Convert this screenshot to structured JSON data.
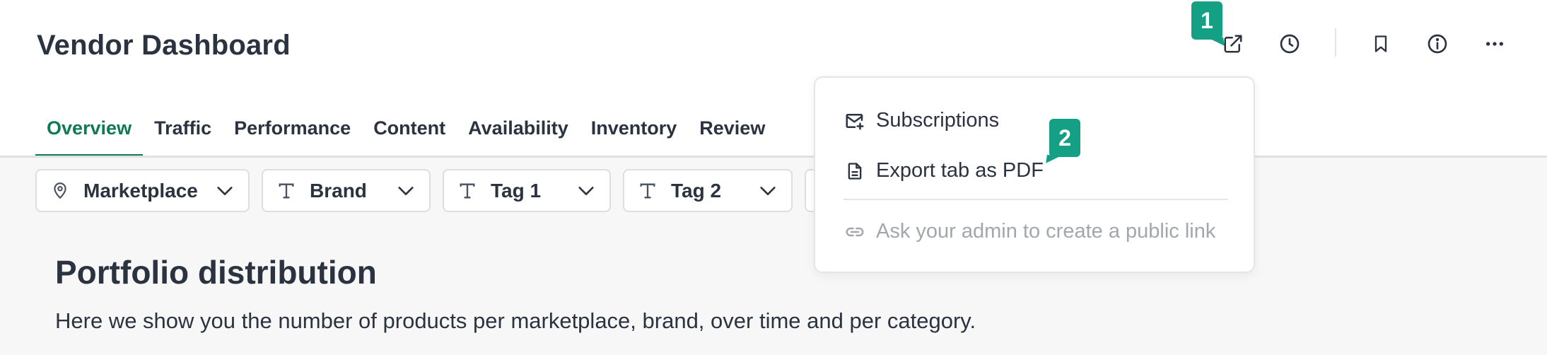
{
  "page": {
    "title": "Vendor Dashboard"
  },
  "toolbar": {
    "icons": [
      "share-external-icon",
      "history-clock-icon",
      "bookmark-icon",
      "info-icon",
      "more-horizontal-icon"
    ]
  },
  "tabs": [
    {
      "label": "Overview",
      "active": true
    },
    {
      "label": "Traffic",
      "active": false
    },
    {
      "label": "Performance",
      "active": false
    },
    {
      "label": "Content",
      "active": false
    },
    {
      "label": "Availability",
      "active": false
    },
    {
      "label": "Inventory",
      "active": false
    },
    {
      "label": "Review",
      "active": false
    }
  ],
  "filters": [
    {
      "label": "Marketplace",
      "icon": "location-pin-icon"
    },
    {
      "label": "Brand",
      "icon": "text-type-icon"
    },
    {
      "label": "Tag 1",
      "icon": "text-type-icon"
    },
    {
      "label": "Tag 2",
      "icon": "text-type-icon"
    }
  ],
  "section": {
    "title": "Portfolio distribution",
    "description": "Here we show you the number of products per marketplace, brand, over time and per category."
  },
  "share_menu": {
    "items": [
      {
        "label": "Subscriptions",
        "icon": "subscription-mail-icon",
        "enabled": true
      },
      {
        "label": "Export tab as PDF",
        "icon": "document-icon",
        "enabled": true
      },
      {
        "label": "Ask your admin to create a public link",
        "icon": "link-icon",
        "enabled": false
      }
    ]
  },
  "markers": {
    "first": "1",
    "second": "2"
  },
  "colors": {
    "accent": "#0f7a55",
    "marker": "#14a085",
    "text": "#2b3340",
    "muted": "#a3a7ad"
  }
}
